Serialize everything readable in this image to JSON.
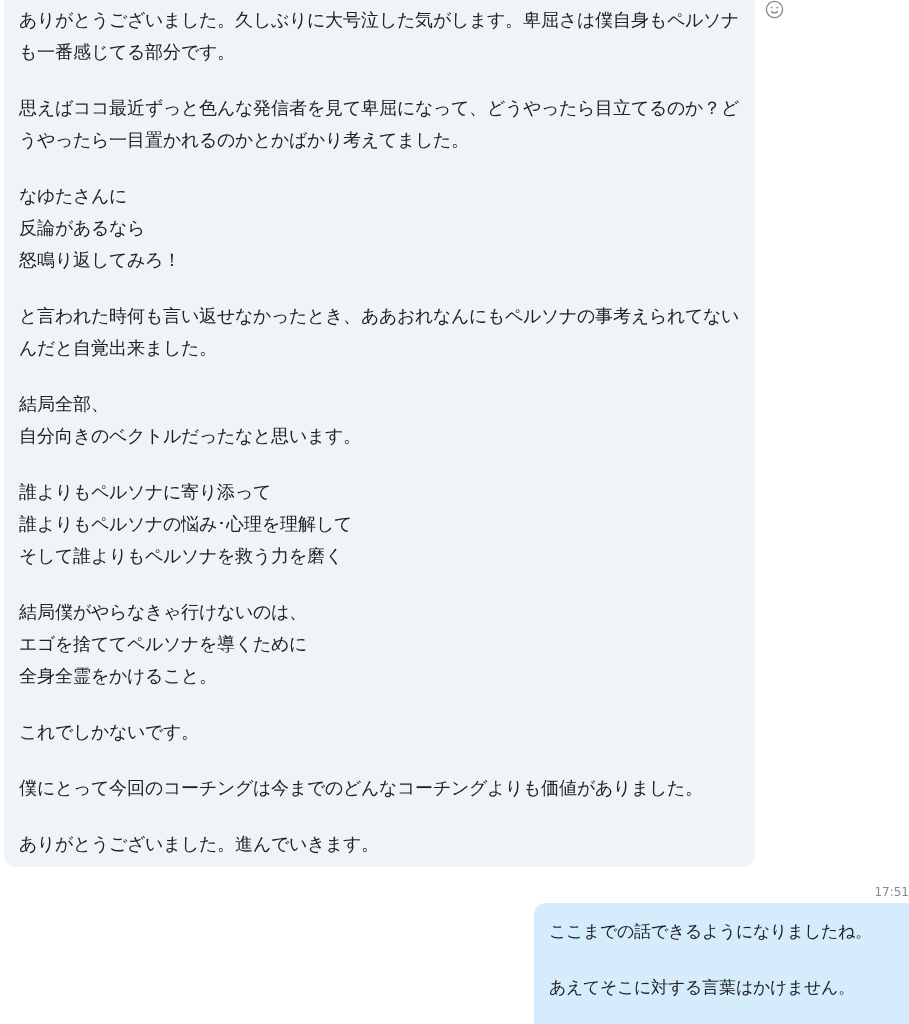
{
  "messages": [
    {
      "kind": "received",
      "paragraphs": [
        [
          "ありがとうございました。久しぶりに大号泣した気がします。卑屈さは僕自身もペルソナも一番感じてる部分です。"
        ],
        [
          "思えばココ最近ずっと色んな発信者を見て卑屈になって、どうやったら目立てるのか？どうやったら一目置かれるのかとかばかり考えてました。"
        ],
        [
          "なゆたさんに",
          "反論があるなら",
          "怒鳴り返してみろ！"
        ],
        [
          "と言われた時何も言い返せなかったとき、ああおれなんにもペルソナの事考えられてないんだと自覚出来ました。"
        ],
        [
          "結局全部、",
          "自分向きのベクトルだったなと思います。"
        ],
        [
          "誰よりもペルソナに寄り添って",
          "誰よりもペルソナの悩み･心理を理解して",
          "そして誰よりもペルソナを救う力を磨く"
        ],
        [
          "結局僕がやらなきゃ行けないのは、",
          "エゴを捨ててペルソナを導くために",
          "全身全霊をかけること。"
        ],
        [
          "これでしかないです。"
        ],
        [
          "僕にとって今回のコーチングは今までのどんなコーチングよりも価値がありました。"
        ],
        [
          "ありがとうございました。進んでいきます。"
        ]
      ]
    },
    {
      "kind": "time",
      "text": "17:51"
    },
    {
      "kind": "sent",
      "paragraphs": [
        [
          "ここまでの話できるようになりましたね。"
        ],
        [
          "あえてそこに対する言葉はかけません。"
        ]
      ]
    }
  ]
}
